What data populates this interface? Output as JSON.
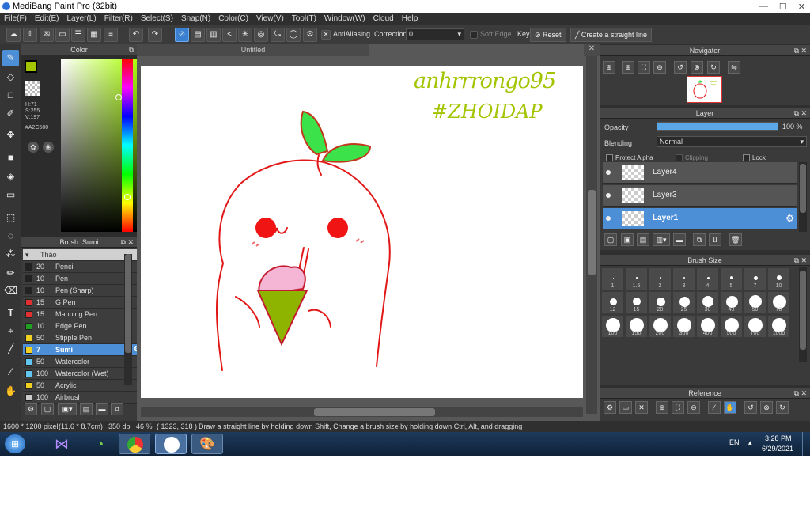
{
  "app": {
    "title": "MediBang Paint Pro (32bit)"
  },
  "window_buttons": [
    "—",
    "☐",
    "✕"
  ],
  "menu": [
    "File(F)",
    "Edit(E)",
    "Layer(L)",
    "Filter(R)",
    "Select(S)",
    "Snap(N)",
    "Color(C)",
    "View(V)",
    "Tool(T)",
    "Window(W)",
    "Cloud",
    "Help"
  ],
  "toolbar": {
    "antialiasing_label": "AntiAliasing",
    "correction_label": "Correction",
    "correction_value": "0",
    "soft_edge_label": "Soft Edge",
    "key_label": "Key",
    "reset_label": "Reset",
    "straight_line_label": "Create a straight line"
  },
  "color_panel": {
    "title": "Color",
    "h": "H:71",
    "s": "S:255",
    "v": "V:197",
    "hex": "#A2C500",
    "main_color": "#a2c500"
  },
  "brush_panel": {
    "title": "Brush: Sumi",
    "group": "Thảo",
    "brushes": [
      {
        "size": "20",
        "name": "Pencil",
        "color": "#222222"
      },
      {
        "size": "10",
        "name": "Pen",
        "color": "#222222"
      },
      {
        "size": "10",
        "name": "Pen (Sharp)",
        "color": "#222222"
      },
      {
        "size": "15",
        "name": "G Pen",
        "color": "#e03030"
      },
      {
        "size": "15",
        "name": "Mapping Pen",
        "color": "#e03030"
      },
      {
        "size": "10",
        "name": "Edge Pen",
        "color": "#20a020"
      },
      {
        "size": "50",
        "name": "Stipple Pen",
        "color": "#f0d020"
      },
      {
        "size": "7",
        "name": "Sumi",
        "color": "#f0d020"
      },
      {
        "size": "50",
        "name": "Watercolor",
        "color": "#60c8f0"
      },
      {
        "size": "100",
        "name": "Watercolor (Wet)",
        "color": "#60c8f0"
      },
      {
        "size": "50",
        "name": "Acrylic",
        "color": "#f0d020"
      },
      {
        "size": "100",
        "name": "Airbrush",
        "color": "#cccccc"
      }
    ]
  },
  "canvas": {
    "tab": "Untitled",
    "handwriting_line1": "anhrrrongo95",
    "handwriting_line2": "#ZHOIDAP"
  },
  "navigator": {
    "title": "Navigator"
  },
  "layer_panel": {
    "title": "Layer",
    "opacity_label": "Opacity",
    "opacity_value": "100 %",
    "opacity_fraction": 1.0,
    "blending_label": "Blending",
    "blending_value": "Normal",
    "protect_alpha": "Protect Alpha",
    "clipping": "Clipping",
    "lock": "Lock",
    "layers": [
      "Layer4",
      "Layer3",
      "Layer1"
    ]
  },
  "brush_size_panel": {
    "title": "Brush Size",
    "sizes": [
      "1",
      "1.5",
      "2",
      "3",
      "4",
      "5",
      "7",
      "10",
      "12",
      "15",
      "20",
      "25",
      "30",
      "40",
      "50",
      "70",
      "100",
      "150",
      "200",
      "300",
      "400",
      "500",
      "700",
      "1000"
    ]
  },
  "reference_panel": {
    "title": "Reference"
  },
  "status": {
    "dimensions": "1600 * 1200 pixel",
    "physical": "(11.6 * 8.7cm)",
    "dpi": "350 dpi",
    "zoom": "46 %",
    "coords": "( 1323, 318 )",
    "hint": "Draw a straight line by holding down Shift, Change a brush size by holding down Ctrl, Alt, and dragging"
  },
  "taskbar": {
    "lang": "EN",
    "time": "3:28 PM",
    "date": "6/29/2021"
  }
}
